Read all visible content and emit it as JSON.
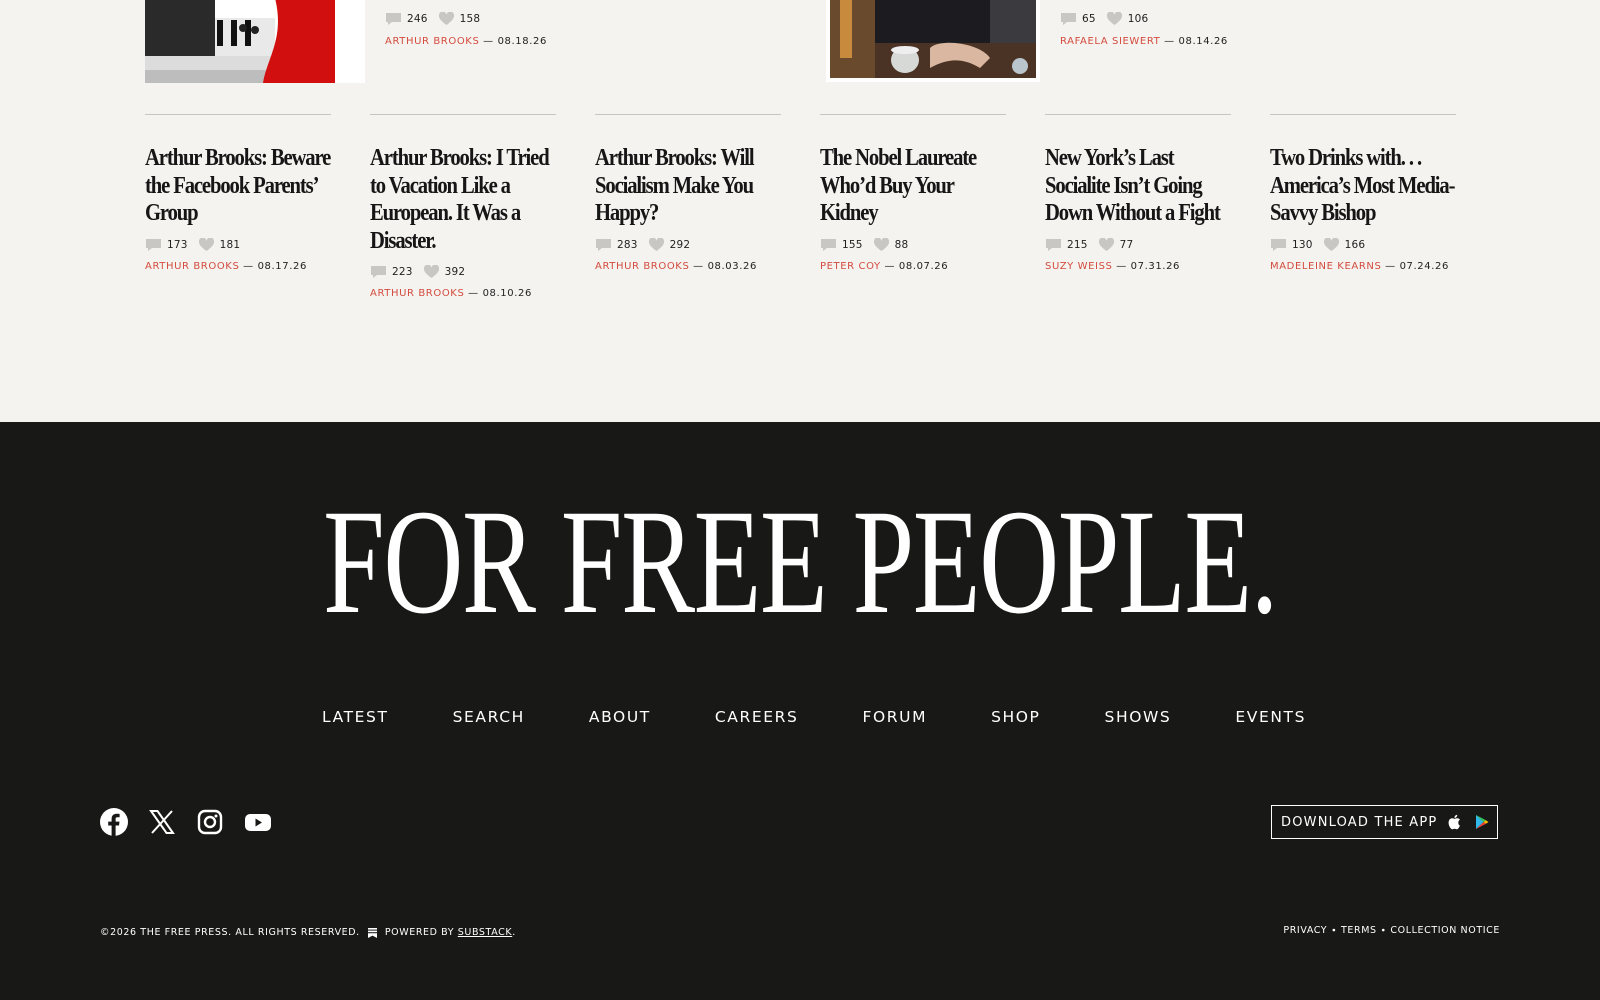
{
  "top_articles": [
    {
      "comments": "246",
      "likes": "158",
      "author": "ARTHUR BROOKS",
      "date": "08.18.26"
    },
    {
      "comments": "65",
      "likes": "106",
      "author": "RAFAELA SIEWERT",
      "date": "08.14.26"
    }
  ],
  "articles": [
    {
      "title": "Arthur Brooks: Beware the Facebook Parents’ Group",
      "comments": "173",
      "likes": "181",
      "author": "ARTHUR BROOKS",
      "date": "08.17.26"
    },
    {
      "title": "Arthur Brooks: I Tried to Vacation Like a European. It Was a Disaster.",
      "comments": "223",
      "likes": "392",
      "author": "ARTHUR BROOKS",
      "date": "08.10.26"
    },
    {
      "title": "Arthur Brooks: Will Socialism Make You Happy?",
      "comments": "283",
      "likes": "292",
      "author": "ARTHUR BROOKS",
      "date": "08.03.26"
    },
    {
      "title": "The Nobel Laureate Who’d Buy Your Kidney",
      "comments": "155",
      "likes": "88",
      "author": "PETER COY",
      "date": "08.07.26"
    },
    {
      "title": "New York’s Last Socialite Isn’t Going Down Without a Fight",
      "comments": "215",
      "likes": "77",
      "author": "SUZY WEISS",
      "date": "07.31.26"
    },
    {
      "title": "Two Drinks with. . . America’s Most Media-Savvy Bishop",
      "comments": "130",
      "likes": "166",
      "author": "MADELEINE KEARNS",
      "date": "07.24.26"
    }
  ],
  "byline_separator": " — ",
  "footer": {
    "tagline": "FOR FREE PEOPLE.",
    "nav": [
      "LATEST",
      "SEARCH",
      "ABOUT",
      "CAREERS",
      "FORUM",
      "SHOP",
      "SHOWS",
      "EVENTS"
    ],
    "social_icons": [
      "facebook-icon",
      "x-icon",
      "instagram-icon",
      "youtube-icon"
    ],
    "app_button": "DOWNLOAD THE APP",
    "copyright": "©2026 THE FREE PRESS. ALL RIGHTS RESERVED.",
    "powered_by": "POWERED BY",
    "substack": "SUBSTACK",
    "period": ".",
    "legal": "PRIVACY ∙ TERMS ∙ COLLECTION NOTICE"
  },
  "colors": {
    "accent": "#d34b3f",
    "footer_bg": "#181817",
    "page_bg": "#f5f3ef"
  }
}
